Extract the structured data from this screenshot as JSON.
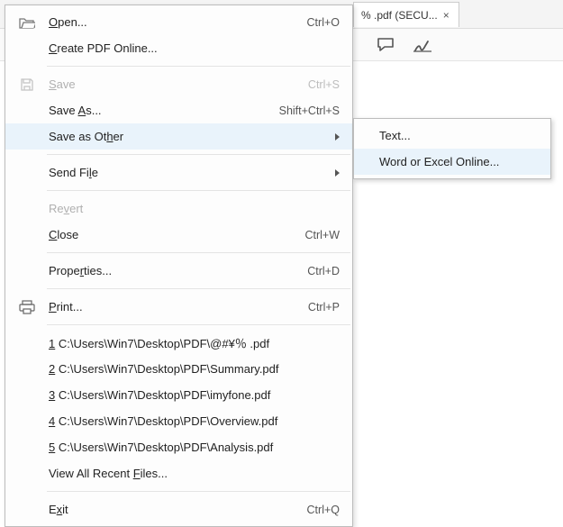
{
  "tab": {
    "title": "% .pdf (SECU...",
    "close": "×"
  },
  "toolbar": {
    "commentIcon": "comment-icon",
    "signIcon": "sign-icon"
  },
  "menu": {
    "open": {
      "label": "Open...",
      "u": "O",
      "shortcut": "Ctrl+O"
    },
    "createOnline": {
      "label": "Create PDF Online...",
      "u": "C"
    },
    "save": {
      "label": "Save",
      "u": "S",
      "shortcut": "Ctrl+S"
    },
    "saveAs": {
      "label": "Save As...",
      "u": "A",
      "shortcut": "Shift+Ctrl+S"
    },
    "saveOther": {
      "label": "Save as Other",
      "u": "h"
    },
    "sendFile": {
      "label": "Send File",
      "u": "l"
    },
    "revert": {
      "label": "Revert",
      "u": "v"
    },
    "close": {
      "label": "Close",
      "u": "C",
      "shortcut": "Ctrl+W"
    },
    "properties": {
      "label": "Properties...",
      "u": "r",
      "shortcut": "Ctrl+D"
    },
    "print": {
      "label": "Print...",
      "u": "P",
      "shortcut": "Ctrl+P"
    },
    "recent": [
      {
        "n": "1",
        "path": "C:\\Users\\Win7\\Desktop\\PDF\\@#¥％ .pdf"
      },
      {
        "n": "2",
        "path": "C:\\Users\\Win7\\Desktop\\PDF\\Summary.pdf"
      },
      {
        "n": "3",
        "path": "C:\\Users\\Win7\\Desktop\\PDF\\imyfone.pdf"
      },
      {
        "n": "4",
        "path": "C:\\Users\\Win7\\Desktop\\PDF\\Overview.pdf"
      },
      {
        "n": "5",
        "path": "C:\\Users\\Win7\\Desktop\\PDF\\Analysis.pdf"
      }
    ],
    "viewAllRecent": {
      "label": "View All Recent Files...",
      "u": "F"
    },
    "exit": {
      "label": "Exit",
      "u": "x",
      "shortcut": "Ctrl+Q"
    }
  },
  "submenu": {
    "text": {
      "label": "Text..."
    },
    "wordExcel": {
      "label": "Word or Excel Online..."
    }
  }
}
